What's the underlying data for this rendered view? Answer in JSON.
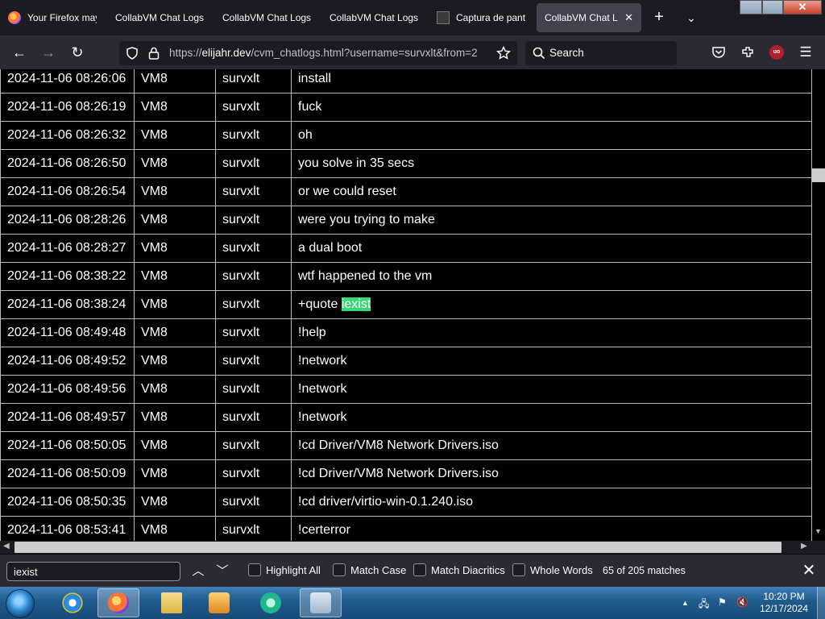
{
  "browser": {
    "tabs": [
      {
        "title": "Your Firefox may"
      },
      {
        "title": "CollabVM Chat Logs"
      },
      {
        "title": "CollabVM Chat Logs"
      },
      {
        "title": "CollabVM Chat Logs"
      },
      {
        "title": "Captura de pant"
      },
      {
        "title": "CollabVM Chat Lo"
      }
    ],
    "url_prefix": "https://",
    "url_host": "elijahr.dev",
    "url_path": "/cvm_chatlogs.html?username=survxlt&from=2",
    "search_placeholder": "Search",
    "extension_badge": "uo"
  },
  "log_rows": [
    {
      "time": "2024-11-06 08:26:06",
      "vm": "VM8",
      "user": "survxlt",
      "msg": "install"
    },
    {
      "time": "2024-11-06 08:26:19",
      "vm": "VM8",
      "user": "survxlt",
      "msg": "fuck"
    },
    {
      "time": "2024-11-06 08:26:32",
      "vm": "VM8",
      "user": "survxlt",
      "msg": "oh"
    },
    {
      "time": "2024-11-06 08:26:50",
      "vm": "VM8",
      "user": "survxlt",
      "msg": "you solve in 35 secs"
    },
    {
      "time": "2024-11-06 08:26:54",
      "vm": "VM8",
      "user": "survxlt",
      "msg": "or we could reset"
    },
    {
      "time": "2024-11-06 08:28:26",
      "vm": "VM8",
      "user": "survxlt",
      "msg": "were you trying to make"
    },
    {
      "time": "2024-11-06 08:28:27",
      "vm": "VM8",
      "user": "survxlt",
      "msg": "a dual boot"
    },
    {
      "time": "2024-11-06 08:38:22",
      "vm": "VM8",
      "user": "survxlt",
      "msg": "wtf happened to the vm"
    },
    {
      "time": "2024-11-06 08:38:24",
      "vm": "VM8",
      "user": "survxlt",
      "msg_prefix": "+quote ",
      "msg_highlight": "iexist"
    },
    {
      "time": "2024-11-06 08:49:48",
      "vm": "VM8",
      "user": "survxlt",
      "msg": "!help"
    },
    {
      "time": "2024-11-06 08:49:52",
      "vm": "VM8",
      "user": "survxlt",
      "msg": "!network"
    },
    {
      "time": "2024-11-06 08:49:56",
      "vm": "VM8",
      "user": "survxlt",
      "msg": "!network"
    },
    {
      "time": "2024-11-06 08:49:57",
      "vm": "VM8",
      "user": "survxlt",
      "msg": "!network"
    },
    {
      "time": "2024-11-06 08:50:05",
      "vm": "VM8",
      "user": "survxlt",
      "msg": "!cd Driver/VM8 Network Drivers.iso"
    },
    {
      "time": "2024-11-06 08:50:09",
      "vm": "VM8",
      "user": "survxlt",
      "msg": "!cd Driver/VM8 Network Drivers.iso"
    },
    {
      "time": "2024-11-06 08:50:35",
      "vm": "VM8",
      "user": "survxlt",
      "msg": "!cd driver/virtio-win-0.1.240.iso"
    },
    {
      "time": "2024-11-06 08:53:41",
      "vm": "VM8",
      "user": "survxlt",
      "msg": "!certerror"
    }
  ],
  "findbar": {
    "query": "iexist",
    "highlight_all": "Highlight All",
    "match_case": "Match Case",
    "match_diacritics": "Match Diacritics",
    "whole_words": "Whole Words",
    "matches": "65 of 205 matches"
  },
  "taskbar": {
    "time": "10:20 PM",
    "date": "12/17/2024"
  },
  "colors": {
    "highlight": "#38d878",
    "page_bg": "#000000",
    "toolbar_bg": "#2b2a33"
  }
}
